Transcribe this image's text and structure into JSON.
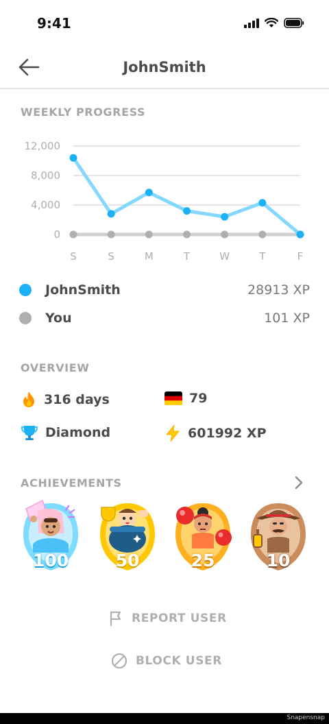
{
  "status_bar": {
    "time": "9:41"
  },
  "header": {
    "title": "JohnSmith"
  },
  "weekly_progress": {
    "title": "WEEKLY PROGRESS"
  },
  "chart_data": {
    "type": "line",
    "categories": [
      "S",
      "S",
      "M",
      "T",
      "W",
      "T",
      "F"
    ],
    "y_ticks": [
      "12,000",
      "8,000",
      "4,000",
      "0"
    ],
    "ylim": [
      0,
      12000
    ],
    "series": [
      {
        "name": "JohnSmith",
        "color": "#1cb0f6",
        "line_color": "#84d8ff",
        "values": [
          10400,
          2800,
          5700,
          3200,
          2400,
          4300,
          0
        ]
      },
      {
        "name": "You",
        "color": "#afafaf",
        "line_color": "#cfcfcf",
        "values": [
          0,
          0,
          0,
          0,
          0,
          0,
          0
        ]
      }
    ]
  },
  "legend": [
    {
      "name": "JohnSmith",
      "xp": "28913 XP",
      "color": "#1cb0f6"
    },
    {
      "name": "You",
      "xp": "101 XP",
      "color": "#afafaf"
    }
  ],
  "overview": {
    "title": "OVERVIEW",
    "streak": {
      "value": "316 days",
      "icon": "flame-icon"
    },
    "league_rank": {
      "value": "79",
      "icon": "germany-flag-icon"
    },
    "league": {
      "value": "Diamond",
      "icon": "trophy-icon"
    },
    "total_xp": {
      "value": "601992 XP",
      "icon": "lightning-icon"
    }
  },
  "achievements": {
    "title": "ACHIEVEMENTS",
    "badges": [
      {
        "level": "100",
        "color": "#7ddcff",
        "icon": "letter-character-badge"
      },
      {
        "level": "50",
        "color": "#ffc800",
        "icon": "trophy-cauldron-badge"
      },
      {
        "level": "25",
        "color": "#ffb020",
        "icon": "boxer-badge"
      },
      {
        "level": "10",
        "color": "#c98c5a",
        "icon": "explorer-badge"
      }
    ]
  },
  "actions": {
    "report": "REPORT USER",
    "block": "BLOCK USER"
  },
  "footer": {
    "watermark": "Snapensnap"
  }
}
